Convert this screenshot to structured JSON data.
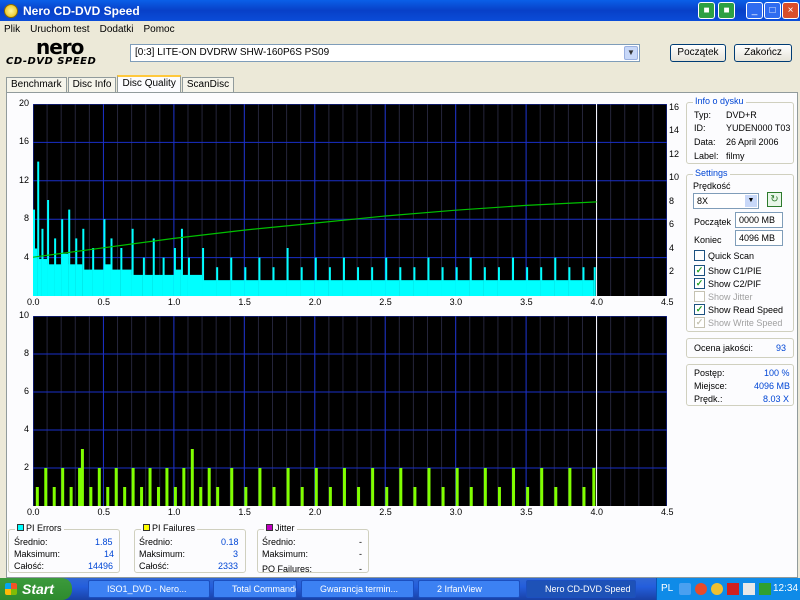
{
  "window": {
    "title": "Nero CD-DVD Speed"
  },
  "menu": [
    "Plik",
    "Uruchom test",
    "Dodatki",
    "Pomoc"
  ],
  "logo": {
    "line1": "nero",
    "line2": "CD-DVD SPEED"
  },
  "drive": {
    "value": "[0:3]  LITE-ON DVDRW SHW-160P6S PS09"
  },
  "buttons": {
    "start": "Początek",
    "end": "Zakończ"
  },
  "tabs": [
    "Benchmark",
    "Disc Info",
    "Disc Quality",
    "ScanDisc"
  ],
  "disc_info": {
    "title": "Info o dysku",
    "type_label": "Typ:",
    "type": "DVD+R",
    "id_label": "ID:",
    "id": "YUDEN000 T03",
    "date_label": "Data:",
    "date": "26 April 2006",
    "label_label": "Label:",
    "label": "filmy"
  },
  "settings": {
    "title": "Settings",
    "speed_label": "Prędkość",
    "speed": "8X",
    "start_label": "Początek",
    "start": "0000 MB",
    "end_label": "Koniec",
    "end": "4096 MB",
    "quick_scan": "Quick Scan",
    "c1": "Show C1/PIE",
    "c2": "Show C2/PIF",
    "jitter": "Show Jitter",
    "read_speed": "Show Read Speed",
    "write_speed": "Show Write Speed"
  },
  "quality": {
    "label": "Ocena jakości:",
    "value": "93"
  },
  "progress": {
    "progress_label": "Postęp:",
    "progress": "100 %",
    "place_label": "Miejsce:",
    "place": "4096 MB",
    "speed_label": "Prędk.:",
    "speed": "8.03 X"
  },
  "pi_errors": {
    "title": "PI Errors",
    "color": "#00FFFF",
    "avg_label": "Średnio:",
    "avg": "1.85",
    "max_label": "Maksimum:",
    "max": "14",
    "total_label": "Całość:",
    "total": "14496"
  },
  "pi_failures": {
    "title": "PI Failures",
    "color": "#FFFF00",
    "avg_label": "Średnio:",
    "avg": "0.18",
    "max_label": "Maksimum:",
    "max": "3",
    "total_label": "Całość:",
    "total": "2333"
  },
  "jitter": {
    "title": "Jitter",
    "color": "#C000C0",
    "avg_label": "Średnio:",
    "avg": "-",
    "max_label": "Maksimum:",
    "max": "-",
    "po_label": "PO Failures:",
    "po": "-"
  },
  "taskbar": {
    "start": "Start",
    "tasks": [
      "ISO1_DVD - Nero...",
      "Total Commander...",
      "Gwarancja termin...",
      "2 IrfanView",
      "Nero CD-DVD Speed"
    ],
    "lang": "PL",
    "clock": "12:34"
  },
  "chart_data": [
    {
      "type": "bar",
      "name": "PI Errors",
      "x_range": [
        0,
        4.5
      ],
      "ylim": [
        0,
        20
      ],
      "y_ticks_left": [
        4,
        8,
        12,
        16,
        20
      ],
      "y_ticks_right": [
        2,
        4,
        6,
        8,
        10,
        12,
        14,
        16
      ],
      "x_ticks": [
        "0.0",
        "0.5",
        "1.0",
        "1.5",
        "2.0",
        "2.5",
        "3.0",
        "3.5",
        "4.0",
        "4.5"
      ],
      "scan_end": 4.0,
      "pie_color": "#00FFFF",
      "speed_color": "#00C000",
      "read_speed": {
        "x": [
          0.0,
          0.5,
          1.0,
          1.5,
          2.0,
          2.5,
          3.0,
          3.5,
          4.0
        ],
        "y": [
          3.3,
          4.1,
          4.9,
          5.6,
          6.2,
          6.8,
          7.3,
          7.7,
          8.0
        ]
      },
      "pie_samples": [
        {
          "x": 0.0,
          "y": 9
        },
        {
          "x": 0.03,
          "y": 14
        },
        {
          "x": 0.06,
          "y": 7
        },
        {
          "x": 0.1,
          "y": 10
        },
        {
          "x": 0.15,
          "y": 6
        },
        {
          "x": 0.2,
          "y": 8
        },
        {
          "x": 0.25,
          "y": 9
        },
        {
          "x": 0.3,
          "y": 6
        },
        {
          "x": 0.35,
          "y": 7
        },
        {
          "x": 0.42,
          "y": 5
        },
        {
          "x": 0.5,
          "y": 8
        },
        {
          "x": 0.55,
          "y": 6
        },
        {
          "x": 0.62,
          "y": 5
        },
        {
          "x": 0.7,
          "y": 7
        },
        {
          "x": 0.78,
          "y": 4
        },
        {
          "x": 0.85,
          "y": 6
        },
        {
          "x": 0.92,
          "y": 4
        },
        {
          "x": 1.0,
          "y": 5
        },
        {
          "x": 1.05,
          "y": 7
        },
        {
          "x": 1.1,
          "y": 4
        },
        {
          "x": 1.2,
          "y": 5
        },
        {
          "x": 1.3,
          "y": 3
        },
        {
          "x": 1.4,
          "y": 4
        },
        {
          "x": 1.5,
          "y": 3
        },
        {
          "x": 1.6,
          "y": 4
        },
        {
          "x": 1.7,
          "y": 3
        },
        {
          "x": 1.8,
          "y": 5
        },
        {
          "x": 1.9,
          "y": 3
        },
        {
          "x": 2.0,
          "y": 4
        },
        {
          "x": 2.1,
          "y": 3
        },
        {
          "x": 2.2,
          "y": 4
        },
        {
          "x": 2.3,
          "y": 3
        },
        {
          "x": 2.4,
          "y": 3
        },
        {
          "x": 2.5,
          "y": 4
        },
        {
          "x": 2.6,
          "y": 3
        },
        {
          "x": 2.7,
          "y": 3
        },
        {
          "x": 2.8,
          "y": 4
        },
        {
          "x": 2.9,
          "y": 3
        },
        {
          "x": 3.0,
          "y": 3
        },
        {
          "x": 3.1,
          "y": 4
        },
        {
          "x": 3.2,
          "y": 3
        },
        {
          "x": 3.3,
          "y": 3
        },
        {
          "x": 3.4,
          "y": 4
        },
        {
          "x": 3.5,
          "y": 3
        },
        {
          "x": 3.6,
          "y": 3
        },
        {
          "x": 3.7,
          "y": 4
        },
        {
          "x": 3.8,
          "y": 3
        },
        {
          "x": 3.9,
          "y": 3
        },
        {
          "x": 3.98,
          "y": 3
        }
      ]
    },
    {
      "type": "bar",
      "name": "PI Failures",
      "x_range": [
        0,
        4.5
      ],
      "ylim": [
        0,
        10
      ],
      "y_ticks_left": [
        2,
        4,
        6,
        8,
        10
      ],
      "x_ticks": [
        "0.0",
        "0.5",
        "1.0",
        "1.5",
        "2.0",
        "2.5",
        "3.0",
        "3.5",
        "4.0",
        "4.5"
      ],
      "scan_end": 4.0,
      "pif_color": "#80FF00",
      "pif_samples": [
        {
          "x": 0.02,
          "y": 1
        },
        {
          "x": 0.08,
          "y": 2
        },
        {
          "x": 0.14,
          "y": 1
        },
        {
          "x": 0.2,
          "y": 2
        },
        {
          "x": 0.26,
          "y": 1
        },
        {
          "x": 0.32,
          "y": 2
        },
        {
          "x": 0.34,
          "y": 3
        },
        {
          "x": 0.4,
          "y": 1
        },
        {
          "x": 0.46,
          "y": 2
        },
        {
          "x": 0.52,
          "y": 1
        },
        {
          "x": 0.58,
          "y": 2
        },
        {
          "x": 0.64,
          "y": 1
        },
        {
          "x": 0.7,
          "y": 2
        },
        {
          "x": 0.76,
          "y": 1
        },
        {
          "x": 0.82,
          "y": 2
        },
        {
          "x": 0.88,
          "y": 1
        },
        {
          "x": 0.94,
          "y": 2
        },
        {
          "x": 1.0,
          "y": 1
        },
        {
          "x": 1.06,
          "y": 2
        },
        {
          "x": 1.12,
          "y": 3
        },
        {
          "x": 1.18,
          "y": 1
        },
        {
          "x": 1.24,
          "y": 2
        },
        {
          "x": 1.3,
          "y": 1
        },
        {
          "x": 1.4,
          "y": 2
        },
        {
          "x": 1.5,
          "y": 1
        },
        {
          "x": 1.6,
          "y": 2
        },
        {
          "x": 1.7,
          "y": 1
        },
        {
          "x": 1.8,
          "y": 2
        },
        {
          "x": 1.9,
          "y": 1
        },
        {
          "x": 2.0,
          "y": 2
        },
        {
          "x": 2.1,
          "y": 1
        },
        {
          "x": 2.2,
          "y": 2
        },
        {
          "x": 2.3,
          "y": 1
        },
        {
          "x": 2.4,
          "y": 2
        },
        {
          "x": 2.5,
          "y": 1
        },
        {
          "x": 2.6,
          "y": 2
        },
        {
          "x": 2.7,
          "y": 1
        },
        {
          "x": 2.8,
          "y": 2
        },
        {
          "x": 2.9,
          "y": 1
        },
        {
          "x": 3.0,
          "y": 2
        },
        {
          "x": 3.1,
          "y": 1
        },
        {
          "x": 3.2,
          "y": 2
        },
        {
          "x": 3.3,
          "y": 1
        },
        {
          "x": 3.4,
          "y": 2
        },
        {
          "x": 3.5,
          "y": 1
        },
        {
          "x": 3.6,
          "y": 2
        },
        {
          "x": 3.7,
          "y": 1
        },
        {
          "x": 3.8,
          "y": 2
        },
        {
          "x": 3.9,
          "y": 1
        },
        {
          "x": 3.97,
          "y": 2
        }
      ]
    }
  ]
}
